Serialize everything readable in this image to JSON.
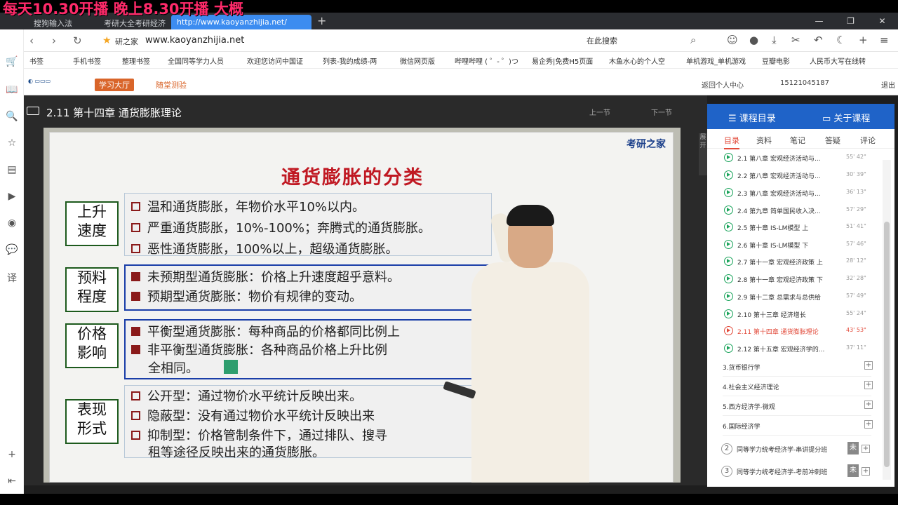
{
  "overlay": {
    "banner": "每天10.30开播  晚上8.30开播 大概"
  },
  "browser": {
    "tabs": [
      "搜狗输入法",
      "考研大全考研经济",
      "http://www.kaoyanzhijia.net/"
    ],
    "new_tab": "+",
    "window_buttons": [
      "—",
      "❐",
      "✕"
    ],
    "site_name": "研之家",
    "url": "www.kaoyanzhijia.net",
    "search_placeholder": "在此搜索",
    "bookmarks": [
      "书签",
      "手机书签",
      "整理书签",
      "全国同等学力人员",
      "欢迎您访问中国证",
      "列表-我的成绩-两",
      "微信网页版",
      "哔哩哔哩 ( ゜- ゜)つ",
      "易企秀|免费H5页面",
      "木鱼水心的个人空",
      "单机游戏_单机游戏",
      "豆瓣电影",
      "人民币大写在线转"
    ]
  },
  "site": {
    "study_hall": "学习大厅",
    "quiz": "随堂测验",
    "back": "返回个人中心",
    "phone": "15121045187",
    "logout": "退出"
  },
  "player": {
    "title": "2.11 第十四章 通货膨胀理论",
    "prev": "上一节",
    "next": "下一节",
    "collapse": "展开"
  },
  "slide": {
    "title": "通货膨胀的分类",
    "logo": "考研之家",
    "groups": [
      {
        "cat": [
          "上升",
          "速度"
        ],
        "rows": [
          "温和通货膨胀，年物价水平10%以内。",
          "严重通货膨胀，10%-100%；奔腾式的通货膨胀。",
          "恶性通货膨胀，100%以上，超级通货膨胀。"
        ]
      },
      {
        "cat": [
          "预料",
          "程度"
        ],
        "rows": [
          "未预期型通货膨胀：价格上升速度超乎意料。",
          "预期型通货膨胀：物价有规律的变动。"
        ]
      },
      {
        "cat": [
          "价格",
          "影响"
        ],
        "rows": [
          "平衡型通货膨胀：每种商品的价格都同比例上",
          "非平衡型通货膨胀：各种商品价格上升比例",
          "全相同。"
        ]
      },
      {
        "cat": [
          "表现",
          "形式"
        ],
        "rows": [
          "公开型：通过物价水平统计反映出来。",
          "隐蔽型：没有通过物价水平统计反映出来",
          "抑制型：价格管制条件下，通过排队、搜寻",
          "租等途径反映出来的通货膨胀。"
        ]
      }
    ]
  },
  "panel": {
    "tabs": [
      "课程目录",
      "关于课程"
    ],
    "subtabs": [
      "目录",
      "资料",
      "笔记",
      "答疑",
      "评论"
    ],
    "lessons": [
      {
        "label": "2.1 第八章 宏观经济活动与...",
        "dur": "55' 42\""
      },
      {
        "label": "2.2 第八章 宏观经济活动与...",
        "dur": "30' 39\""
      },
      {
        "label": "2.3 第八章 宏观经济活动与...",
        "dur": "36' 13\""
      },
      {
        "label": "2.4 第九章 简单国民收入决...",
        "dur": "57' 29\""
      },
      {
        "label": "2.5 第十章 IS-LM模型 上",
        "dur": "51' 41\""
      },
      {
        "label": "2.6 第十章 IS-LM模型 下",
        "dur": "57' 46\""
      },
      {
        "label": "2.7 第十一章 宏观经济政策 上",
        "dur": "28' 12\""
      },
      {
        "label": "2.8 第十一章 宏观经济政策 下",
        "dur": "32' 28\""
      },
      {
        "label": "2.9 第十二章 总需求与总供给",
        "dur": "57' 49\""
      },
      {
        "label": "2.10 第十三章 经济增长",
        "dur": "55' 24\""
      },
      {
        "label": "2.11 第十四章 通货膨胀理论",
        "dur": "43' 53\""
      },
      {
        "label": "2.12 第十五章 宏观经济学的...",
        "dur": "37' 11\""
      }
    ],
    "sections": [
      "3.货币银行学",
      "4.社会主义经济理论",
      "5.西方经济学-微观",
      "6.国际经济学"
    ],
    "courses": [
      {
        "num": "2",
        "label": "同等学力统考经济学-串讲提分班",
        "tag": "未"
      },
      {
        "num": "3",
        "label": "同等学力统考经济学-考前冲刺班",
        "tag": "未"
      }
    ]
  }
}
